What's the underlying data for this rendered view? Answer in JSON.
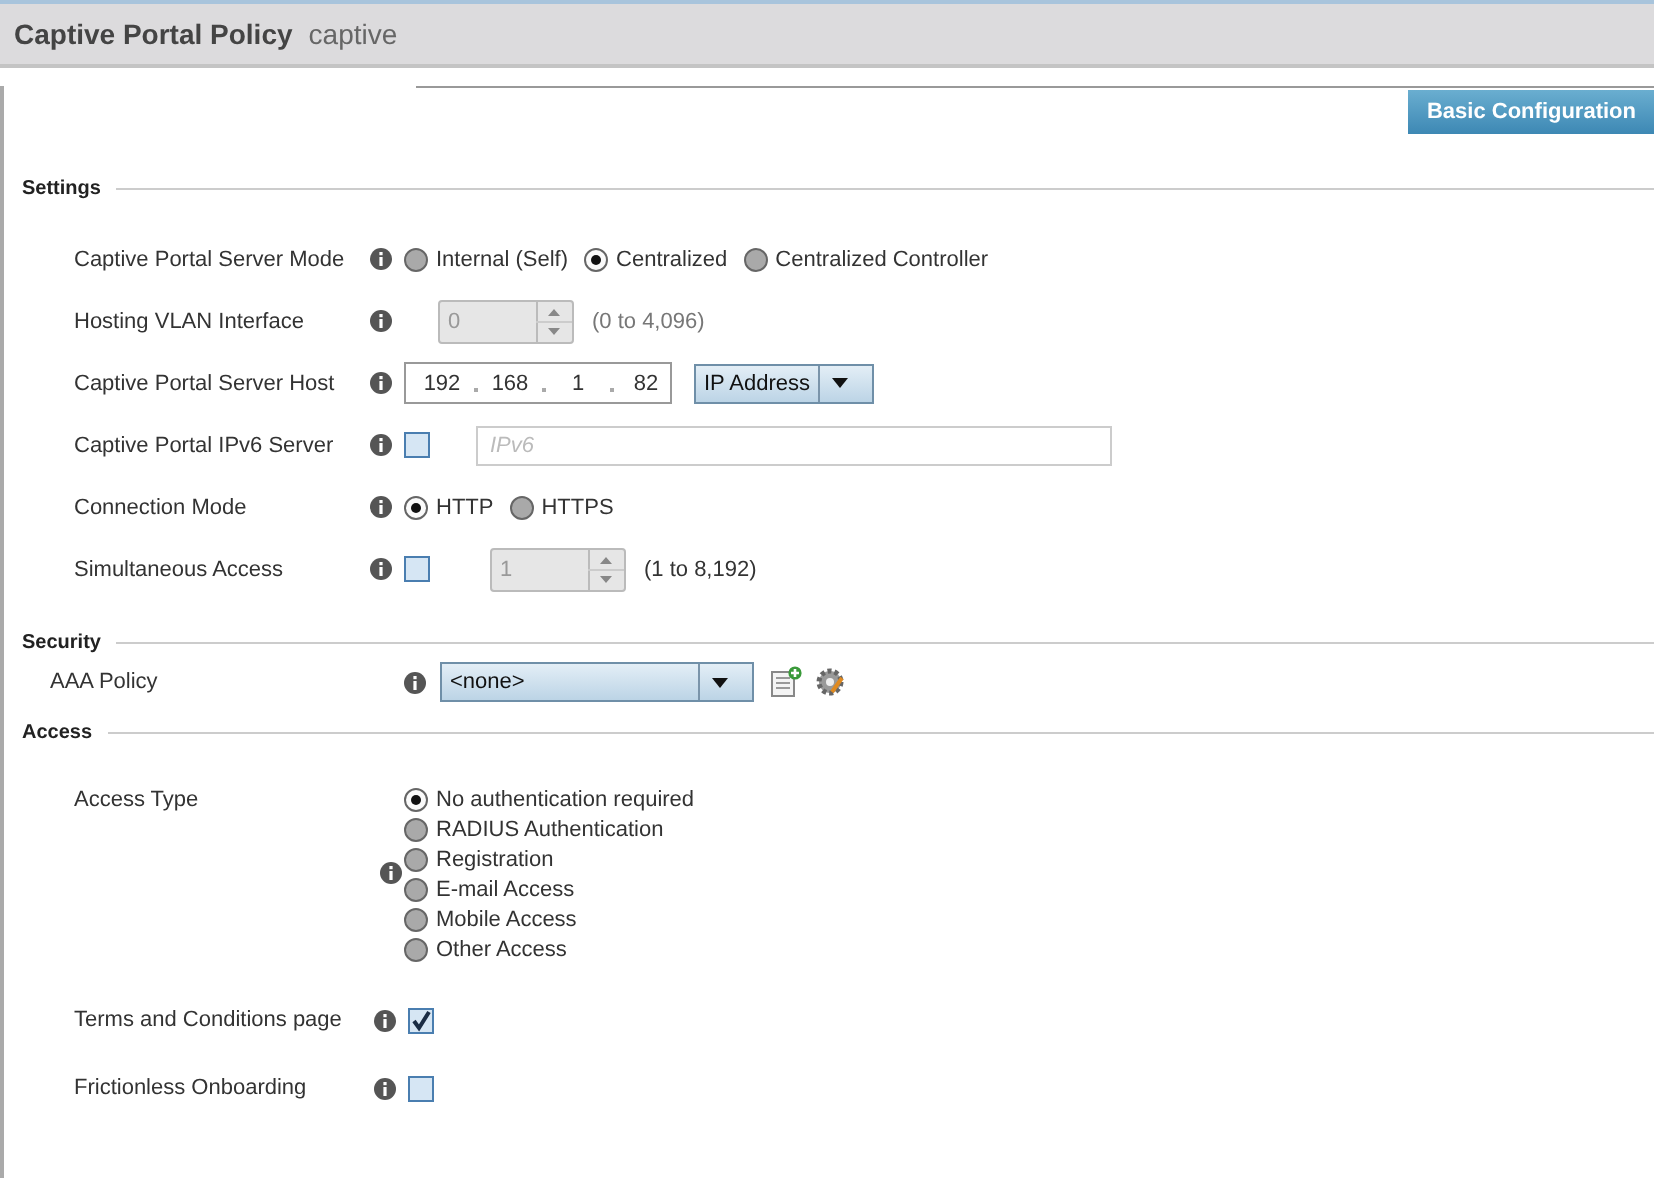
{
  "header": {
    "title": "Captive Portal Policy",
    "name": "captive"
  },
  "tabs": [
    {
      "label": "Basic Configuration",
      "selected": true
    }
  ],
  "settings": {
    "title": "Settings",
    "rows": [
      {
        "label": "Captive Portal Server Mode",
        "kind": "radio",
        "options": [
          {
            "label": "Internal (Self)",
            "selected": false
          },
          {
            "label": "Centralized",
            "selected": true
          },
          {
            "label": "Centralized Controller",
            "selected": false
          }
        ]
      },
      {
        "label": "Hosting VLAN Interface",
        "kind": "spinner",
        "value": "0",
        "disabled": true,
        "range": "(0 to 4,096)"
      },
      {
        "label": "Captive Portal Server Host",
        "kind": "ip",
        "octets": [
          "192",
          "168",
          "1",
          "82"
        ],
        "type": "IP Address"
      },
      {
        "label": "Captive Portal IPv6 Server",
        "kind": "check_field",
        "checked": false,
        "placeholder": "IPv6"
      },
      {
        "label": "Connection Mode",
        "kind": "radio",
        "options": [
          {
            "label": "HTTP",
            "selected": true
          },
          {
            "label": "HTTPS",
            "selected": false
          }
        ]
      },
      {
        "label": "Simultaneous Access",
        "kind": "check_spinner",
        "checked": false,
        "value": "1",
        "disabled": true,
        "range": "(1 to 8,192)"
      }
    ]
  },
  "security": {
    "title": "Security",
    "aaa_policy": {
      "label": "AAA Policy",
      "value": "<none>"
    }
  },
  "access": {
    "title": "Access",
    "access_type": {
      "label": "Access Type",
      "options": [
        {
          "label": "No authentication required",
          "selected": true
        },
        {
          "label": "RADIUS Authentication",
          "selected": false
        },
        {
          "label": "Registration",
          "selected": false
        },
        {
          "label": "E-mail Access",
          "selected": false
        },
        {
          "label": "Mobile Access",
          "selected": false
        },
        {
          "label": "Other Access",
          "selected": false
        }
      ]
    },
    "checks": [
      {
        "label": "Terms and Conditions page",
        "checked": true
      },
      {
        "label": "Frictionless Onboarding",
        "checked": false
      }
    ]
  }
}
